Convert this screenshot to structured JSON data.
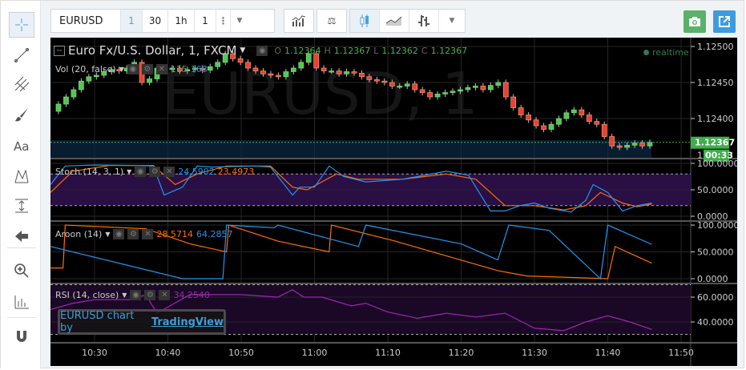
{
  "toolbar": {
    "symbol": "EURUSD",
    "intervals": [
      {
        "label": "1",
        "active": true
      },
      {
        "label": "30",
        "active": false
      },
      {
        "label": "1h",
        "active": false
      },
      {
        "label": "1",
        "active": false
      }
    ],
    "icons": [
      "more-vertical-icon",
      "chevron-down-icon",
      "indicators-icon",
      "compare-scale-icon",
      "candles-icon",
      "area-chart-icon",
      "bars-icon",
      "chevron-down-icon"
    ],
    "snapshot_color": "#5bb16b",
    "popout_color": "#3d9be0"
  },
  "left_tools": [
    "crosshair-icon",
    "trend-line-icon",
    "pitchfork-icon",
    "brush-icon",
    "text-icon",
    "pattern-icon",
    "measure-icon",
    "arrow-left-icon",
    "zoom-in-icon",
    "price-scale-icon",
    "magnet-icon"
  ],
  "main": {
    "title": "Euro Fx/U.S. Dollar, 1, FXCM",
    "watermark": "EURUSD, 1",
    "ohlc": {
      "o_label": "O",
      "o": "1.12364",
      "h_label": "H",
      "h": "1.12367",
      "l_label": "L",
      "l": "1.12362",
      "c_label": "C",
      "c": "1.12367"
    },
    "realtime": "realtime",
    "volume_legend": "Vol (20, false)",
    "volume_values": [
      "115",
      "163"
    ],
    "last_price": "1.12367",
    "countdown": "00:33",
    "countdown_prefix": "1.",
    "price_ticks": [
      "1.12500",
      "1.12450",
      "1.12400"
    ],
    "colors": {
      "up": "#4caf50",
      "down": "#e53935",
      "up_fill": "#53c653",
      "down_fill": "#e84135"
    },
    "start_close": 1.1241,
    "closes": [
      1.1242,
      1.1243,
      1.1244,
      1.12452,
      1.12458,
      1.1246,
      1.12465,
      1.12468,
      1.12466,
      1.1247,
      1.12478,
      1.1245,
      1.12455,
      1.1247,
      1.12468,
      1.1247,
      1.12466,
      1.12468,
      1.1247,
      1.12467,
      1.12472,
      1.12478,
      1.1249,
      1.12483,
      1.12478,
      1.1247,
      1.12466,
      1.12462,
      1.1246,
      1.12458,
      1.12465,
      1.1247,
      1.12478,
      1.1249,
      1.1247,
      1.12466,
      1.12466,
      1.12462,
      1.12465,
      1.12463,
      1.12458,
      1.12454,
      1.12452,
      1.1245,
      1.12445,
      1.12445,
      1.12448,
      1.1244,
      1.12436,
      1.1243,
      1.12434,
      1.12436,
      1.12438,
      1.1244,
      1.12443,
      1.12445,
      1.1244,
      1.12446,
      1.1245,
      1.1243,
      1.12415,
      1.12405,
      1.12398,
      1.1239,
      1.12385,
      1.12392,
      1.124,
      1.12408,
      1.12412,
      1.12405,
      1.12396,
      1.12392,
      1.12375,
      1.12362,
      1.1236,
      1.12363,
      1.12366,
      1.12362,
      1.12367
    ]
  },
  "stoch": {
    "legend": "Stoch (14, 3, 1)",
    "k_value": "24.5902",
    "d_value": "23.4973",
    "ticks": [
      "100.0000",
      "50.0000",
      "0.0000"
    ],
    "k_color": "#2196f3",
    "d_color": "#ff6d00",
    "k": [
      [
        -6,
        60
      ],
      [
        -4,
        95
      ],
      [
        0,
        97
      ],
      [
        6,
        96
      ],
      [
        8,
        95
      ],
      [
        9.5,
        40
      ],
      [
        12,
        55
      ],
      [
        14,
        95
      ],
      [
        16,
        93
      ],
      [
        22,
        95
      ],
      [
        24,
        93
      ],
      [
        27,
        40
      ],
      [
        28,
        55
      ],
      [
        30,
        55
      ],
      [
        32,
        95
      ],
      [
        34,
        75
      ],
      [
        37,
        65
      ],
      [
        42,
        70
      ],
      [
        48,
        85
      ],
      [
        51,
        78
      ],
      [
        54,
        10
      ],
      [
        56,
        10
      ],
      [
        58,
        20
      ],
      [
        60,
        25
      ],
      [
        62,
        15
      ],
      [
        65,
        8
      ],
      [
        67,
        30
      ],
      [
        68,
        60
      ],
      [
        70,
        45
      ],
      [
        72,
        10
      ],
      [
        74,
        20
      ],
      [
        76,
        25
      ]
    ],
    "d": [
      [
        -6,
        45
      ],
      [
        -3,
        85
      ],
      [
        2,
        96
      ],
      [
        8,
        96
      ],
      [
        11,
        60
      ],
      [
        14,
        80
      ],
      [
        18,
        95
      ],
      [
        24,
        95
      ],
      [
        27,
        55
      ],
      [
        29,
        50
      ],
      [
        33,
        80
      ],
      [
        36,
        70
      ],
      [
        42,
        70
      ],
      [
        48,
        80
      ],
      [
        52,
        70
      ],
      [
        56,
        20
      ],
      [
        60,
        20
      ],
      [
        64,
        12
      ],
      [
        67,
        20
      ],
      [
        69,
        45
      ],
      [
        72,
        25
      ],
      [
        74,
        18
      ],
      [
        76,
        23
      ]
    ]
  },
  "aroon": {
    "legend": "Aroon (14)",
    "down_value": "28.5714",
    "up_value": "64.2857",
    "ticks": [
      "100.0000",
      "50.0000",
      "0.0000"
    ],
    "up_color": "#2196f3",
    "down_color": "#ff6d00",
    "down": [
      [
        -6,
        20
      ],
      [
        -4.3,
        20
      ],
      [
        -4,
        100
      ],
      [
        7,
        93
      ],
      [
        13,
        65
      ],
      [
        18,
        50
      ],
      [
        18.3,
        100
      ],
      [
        25,
        70
      ],
      [
        32,
        50
      ],
      [
        32.3,
        100
      ],
      [
        41,
        70
      ],
      [
        55,
        15
      ],
      [
        59,
        5
      ],
      [
        70,
        0
      ],
      [
        71,
        60
      ],
      [
        76,
        29
      ]
    ],
    "up": [
      [
        -6,
        60
      ],
      [
        12,
        0
      ],
      [
        17.5,
        0
      ],
      [
        18,
        100
      ],
      [
        24.5,
        95
      ],
      [
        25,
        100
      ],
      [
        36,
        60
      ],
      [
        37,
        100
      ],
      [
        50,
        65
      ],
      [
        55,
        35
      ],
      [
        56.5,
        100
      ],
      [
        62,
        90
      ],
      [
        69,
        0
      ],
      [
        70,
        100
      ],
      [
        76,
        64
      ]
    ]
  },
  "rsi": {
    "legend": "RSI (14, close)",
    "value": "34.2540",
    "ticks": [
      "60.0000",
      "40.0000"
    ],
    "color": "#9c27b0",
    "values": [
      [
        -6,
        50
      ],
      [
        -3,
        55
      ],
      [
        0,
        58
      ],
      [
        5,
        58
      ],
      [
        7,
        62
      ],
      [
        8.5,
        47
      ],
      [
        10,
        52
      ],
      [
        13,
        62
      ],
      [
        20,
        62
      ],
      [
        25,
        60
      ],
      [
        27,
        66
      ],
      [
        28.5,
        60
      ],
      [
        31,
        60
      ],
      [
        35,
        53
      ],
      [
        37,
        55
      ],
      [
        40,
        48
      ],
      [
        44,
        43
      ],
      [
        48,
        47
      ],
      [
        52,
        44
      ],
      [
        56,
        47
      ],
      [
        60,
        35
      ],
      [
        64,
        33
      ],
      [
        67,
        40
      ],
      [
        70,
        45
      ],
      [
        73,
        40
      ],
      [
        76,
        34
      ]
    ]
  },
  "time_ticks": [
    "10:30",
    "10:40",
    "10:50",
    "11:00",
    "11:10",
    "11:20",
    "11:30",
    "11:40",
    "11:50"
  ],
  "branding": {
    "prefix": "EURUSD chart by",
    "link": "TradingView"
  }
}
